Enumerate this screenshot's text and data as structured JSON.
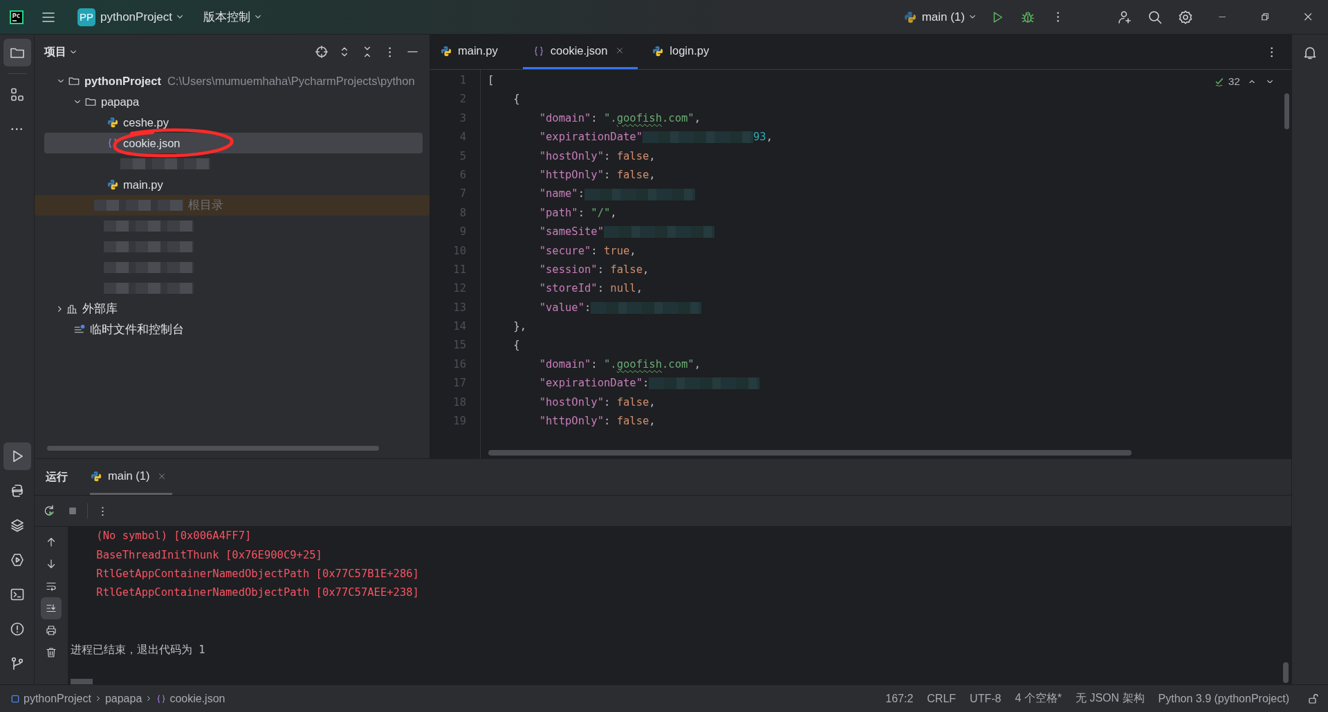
{
  "title_bar": {
    "project": {
      "badge": "PP",
      "name": "pythonProject"
    },
    "vcs": "版本控制",
    "run_config": "main (1)"
  },
  "project_panel": {
    "title": "项目",
    "tree": [
      {
        "label": "pythonProject",
        "kind": "folder",
        "path": "C:\\Users\\mumuemhaha\\PycharmProjects\\python",
        "expanded": true,
        "selected": false,
        "children": [
          {
            "label": "papapa",
            "kind": "folder",
            "expanded": true,
            "selected": false,
            "highlighted": false,
            "children": [
              {
                "label": "ceshe.py",
                "kind": "python",
                "selected": false,
                "circled": false
              },
              {
                "label": "cookie.json",
                "kind": "json",
                "selected": true,
                "circled": true
              },
              {
                "kind": "redacted"
              },
              {
                "label": "main.py",
                "kind": "python",
                "selected": false,
                "circled": false
              }
            ]
          },
          {
            "kind": "redacted",
            "label": "根目录",
            "highlighted": true
          },
          {
            "kind": "redacted",
            "highlighted": false
          },
          {
            "kind": "redacted",
            "highlighted": false
          },
          {
            "kind": "redacted",
            "highlighted": false
          },
          {
            "kind": "redacted",
            "highlighted": false
          }
        ]
      },
      {
        "label": "外部库",
        "kind": "library",
        "expanded": false,
        "selected": false
      },
      {
        "label": "临时文件和控制台",
        "kind": "scratch",
        "selected": false
      }
    ]
  },
  "editor": {
    "tabs": [
      {
        "label": "main.py",
        "kind": "python",
        "selected": false
      },
      {
        "label": "cookie.json",
        "kind": "json",
        "selected": true
      },
      {
        "label": "login.py",
        "kind": "python",
        "selected": false
      }
    ],
    "inspection_count": "32",
    "lines": [
      {
        "number": "1",
        "tokens": [
          {
            "kind": "punct",
            "text": "["
          }
        ]
      },
      {
        "number": "2",
        "tokens": [
          {
            "kind": "punct",
            "text": "    {"
          }
        ]
      },
      {
        "number": "3",
        "tokens": [
          {
            "kind": "key",
            "text": "        \"domain\""
          },
          {
            "kind": "punct",
            "text": ": "
          },
          {
            "kind": "string",
            "text": "\"."
          },
          {
            "kind": "typo",
            "text": "goofish"
          },
          {
            "kind": "string",
            "text": ".com\""
          },
          {
            "kind": "punct",
            "text": ","
          }
        ]
      },
      {
        "number": "4",
        "tokens": [
          {
            "kind": "key",
            "text": "        \"expirationDate\""
          },
          {
            "kind": "redacted"
          },
          {
            "kind": "number",
            "text": "93"
          },
          {
            "kind": "punct",
            "text": ","
          }
        ]
      },
      {
        "number": "5",
        "tokens": [
          {
            "kind": "key",
            "text": "        \"hostOnly\""
          },
          {
            "kind": "punct",
            "text": ": "
          },
          {
            "kind": "literal",
            "text": "false"
          },
          {
            "kind": "punct",
            "text": ","
          }
        ]
      },
      {
        "number": "6",
        "tokens": [
          {
            "kind": "key",
            "text": "        \"httpOnly\""
          },
          {
            "kind": "punct",
            "text": ": "
          },
          {
            "kind": "literal",
            "text": "false"
          },
          {
            "kind": "punct",
            "text": ","
          }
        ]
      },
      {
        "number": "7",
        "tokens": [
          {
            "kind": "key",
            "text": "        \"name\""
          },
          {
            "kind": "punct",
            "text": ":"
          },
          {
            "kind": "redacted"
          }
        ]
      },
      {
        "number": "8",
        "tokens": [
          {
            "kind": "key",
            "text": "        \"path\""
          },
          {
            "kind": "punct",
            "text": ": "
          },
          {
            "kind": "string",
            "text": "\"/\""
          },
          {
            "kind": "punct",
            "text": ","
          }
        ]
      },
      {
        "number": "9",
        "tokens": [
          {
            "kind": "key",
            "text": "        \"sameSite\""
          },
          {
            "kind": "redacted"
          }
        ]
      },
      {
        "number": "10",
        "tokens": [
          {
            "kind": "key",
            "text": "        \"secure\""
          },
          {
            "kind": "punct",
            "text": ": "
          },
          {
            "kind": "literal",
            "text": "true"
          },
          {
            "kind": "punct",
            "text": ","
          }
        ]
      },
      {
        "number": "11",
        "tokens": [
          {
            "kind": "key",
            "text": "        \"session\""
          },
          {
            "kind": "punct",
            "text": ": "
          },
          {
            "kind": "literal",
            "text": "false"
          },
          {
            "kind": "punct",
            "text": ","
          }
        ]
      },
      {
        "number": "12",
        "tokens": [
          {
            "kind": "key",
            "text": "        \"storeId\""
          },
          {
            "kind": "punct",
            "text": ": "
          },
          {
            "kind": "literal",
            "text": "null"
          },
          {
            "kind": "punct",
            "text": ","
          }
        ]
      },
      {
        "number": "13",
        "tokens": [
          {
            "kind": "key",
            "text": "        \"value\""
          },
          {
            "kind": "punct",
            "text": ":"
          },
          {
            "kind": "redacted"
          }
        ]
      },
      {
        "number": "14",
        "tokens": [
          {
            "kind": "punct",
            "text": "    },"
          }
        ]
      },
      {
        "number": "15",
        "tokens": [
          {
            "kind": "punct",
            "text": "    {"
          }
        ]
      },
      {
        "number": "16",
        "tokens": [
          {
            "kind": "key",
            "text": "        \"domain\""
          },
          {
            "kind": "punct",
            "text": ": "
          },
          {
            "kind": "string",
            "text": "\"."
          },
          {
            "kind": "typo",
            "text": "goofish"
          },
          {
            "kind": "string",
            "text": ".com\""
          },
          {
            "kind": "punct",
            "text": ","
          }
        ]
      },
      {
        "number": "17",
        "tokens": [
          {
            "kind": "key",
            "text": "        \"expirationDate\""
          },
          {
            "kind": "punct",
            "text": ":"
          },
          {
            "kind": "redacted"
          }
        ]
      },
      {
        "number": "18",
        "tokens": [
          {
            "kind": "key",
            "text": "        \"hostOnly\""
          },
          {
            "kind": "punct",
            "text": ": "
          },
          {
            "kind": "literal",
            "text": "false"
          },
          {
            "kind": "punct",
            "text": ","
          }
        ]
      },
      {
        "number": "19",
        "tokens": [
          {
            "kind": "key",
            "text": "        \"httpOnly\""
          },
          {
            "kind": "punct",
            "text": ": "
          },
          {
            "kind": "literal",
            "text": "false"
          },
          {
            "kind": "punct",
            "text": ","
          }
        ]
      }
    ]
  },
  "run_panel": {
    "label": "运行",
    "tabs": [
      {
        "label": "main (1)",
        "selected": true
      }
    ],
    "console": [
      {
        "kind": "error",
        "text": "    (No symbol) [0x006A4FF7]"
      },
      {
        "kind": "error",
        "text": "    BaseThreadInitThunk [0x76E900C9+25]"
      },
      {
        "kind": "error",
        "text": "    RtlGetAppContainerNamedObjectPath [0x77C57B1E+286]"
      },
      {
        "kind": "error",
        "text": "    RtlGetAppContainerNamedObjectPath [0x77C57AEE+238]"
      },
      {
        "kind": "blank"
      },
      {
        "kind": "blank"
      },
      {
        "kind": "info",
        "text": "进程已结束，退出代码为 1"
      }
    ]
  },
  "status_bar": {
    "breadcrumbs": [
      {
        "label": "pythonProject",
        "kind": "module"
      },
      {
        "label": "papapa",
        "kind": "folder"
      },
      {
        "label": "cookie.json",
        "kind": "json"
      }
    ],
    "items": [
      "167:2",
      "CRLF",
      "UTF-8",
      "4 个空格*",
      "无 JSON 架构",
      "Python 3.9 (pythonProject)"
    ]
  }
}
